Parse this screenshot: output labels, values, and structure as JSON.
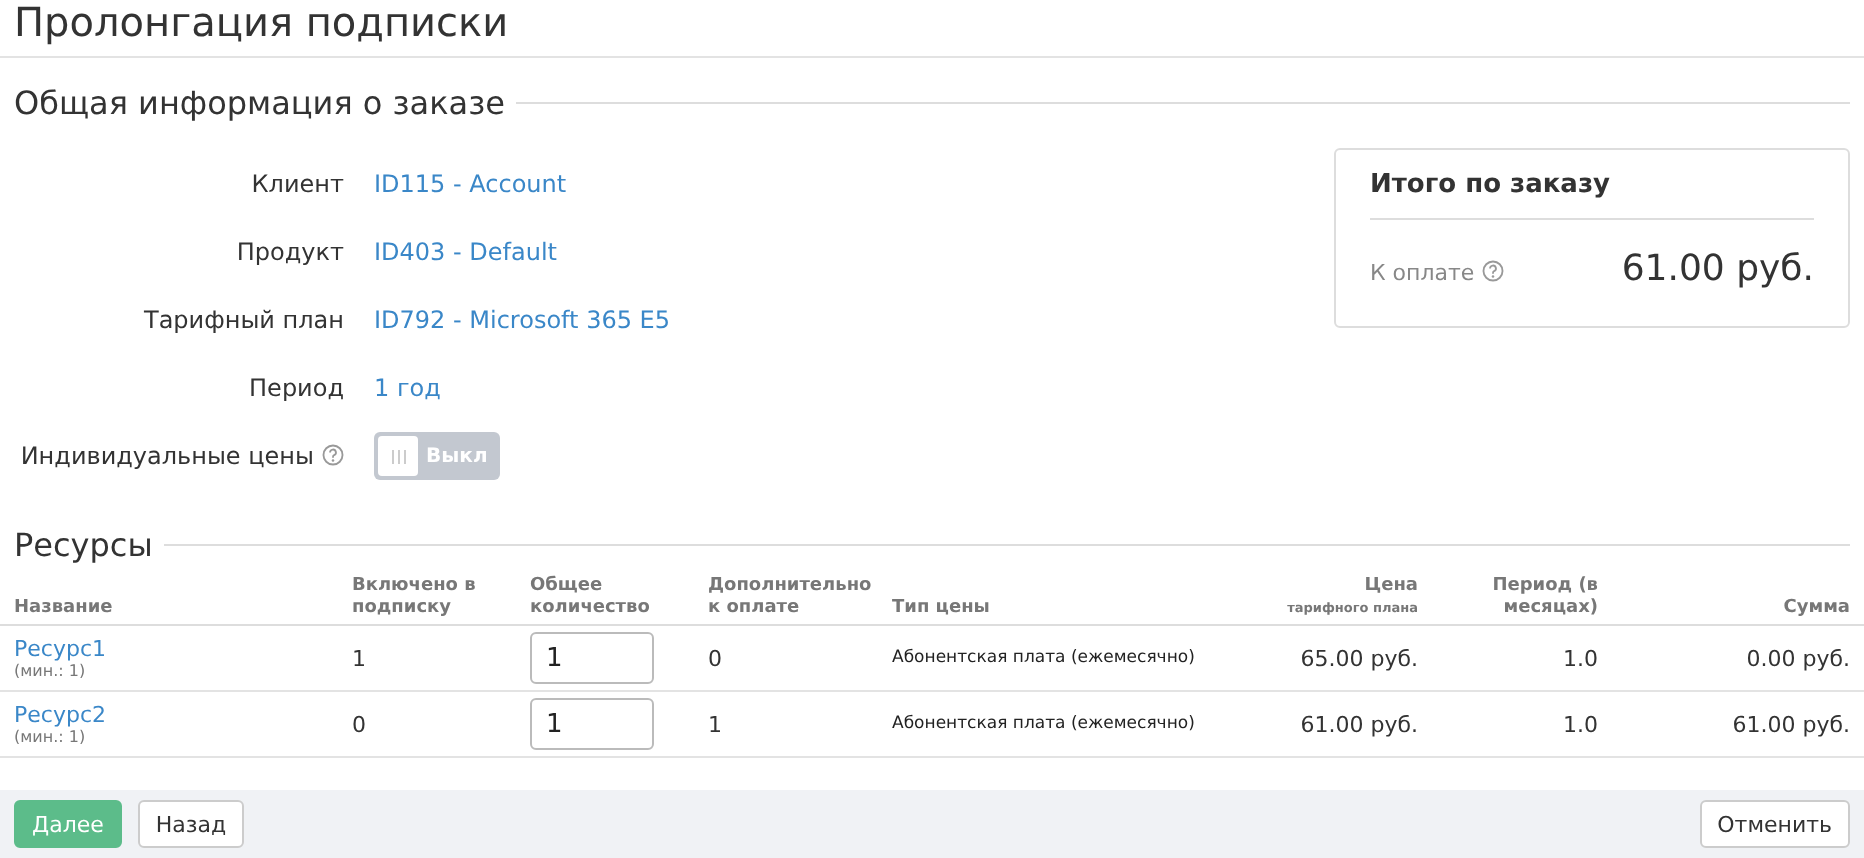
{
  "page_title": "Пролонгация подписки",
  "order_section": {
    "title": "Общая информация о заказе",
    "fields": [
      {
        "label": "Клиент",
        "value": "ID115 - Account"
      },
      {
        "label": "Продукт",
        "value": "ID403 - Default"
      },
      {
        "label": "Тарифный план",
        "value": "ID792 - Microsoft 365 E5"
      },
      {
        "label": "Период",
        "value": "1 год"
      }
    ],
    "individual_prices": {
      "label": "Индивидуальные цены",
      "on": false,
      "toggle_text": "Выкл"
    }
  },
  "summary": {
    "title": "Итого по заказу",
    "label": "К оплате",
    "amount": "61.00 руб."
  },
  "resources": {
    "title": "Ресурсы",
    "columns": [
      {
        "title": "Название"
      },
      {
        "title": "Включено в подписку"
      },
      {
        "title": "Общее количество"
      },
      {
        "title": "Дополнительно к оплате"
      },
      {
        "title": "Тип цены"
      },
      {
        "title": "Цена",
        "subtitle": "тарифного плана"
      },
      {
        "title": "Период (в месяцах)"
      },
      {
        "title": "Сумма"
      }
    ],
    "rows": [
      {
        "name": "Ресурс1",
        "min": "(мин.: 1)",
        "included": "1",
        "quantity": "1",
        "extra": "0",
        "price_type": "Абонентская плата (ежемесячно)",
        "price": "65.00 руб.",
        "period": "1.0",
        "sum": "0.00 руб."
      },
      {
        "name": "Ресурс2",
        "min": "(мин.: 1)",
        "included": "0",
        "quantity": "1",
        "extra": "1",
        "price_type": "Абонентская плата (ежемесячно)",
        "price": "61.00 руб.",
        "period": "1.0",
        "sum": "61.00 руб."
      }
    ]
  },
  "buttons": [
    {
      "label": "Далее",
      "kind": "primary"
    },
    {
      "label": "Назад",
      "kind": "default"
    },
    {
      "label": "Отменить",
      "kind": "default"
    }
  ]
}
